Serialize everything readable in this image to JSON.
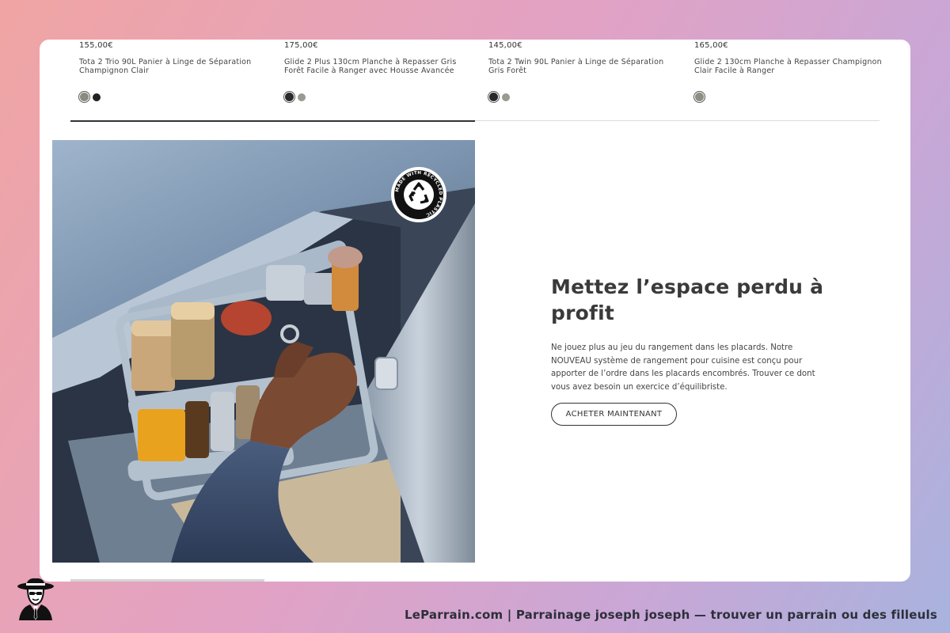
{
  "products": [
    {
      "price": "155,00€",
      "name": "Tota 2 Trio 90L Panier à Linge de Séparation Champignon Clair",
      "swatches": [
        "#8a8a80",
        "#222222"
      ],
      "selected": 0
    },
    {
      "price": "175,00€",
      "name": "Glide 2 Plus 130cm Planche à Repasser Gris Forêt Facile à Ranger avec Housse Avancée",
      "swatches": [
        "#2a2a2a",
        "#9a9a90"
      ],
      "selected": 0
    },
    {
      "price": "145,00€",
      "name": "Tota 2 Twin 90L Panier à Linge de Séparation Gris Forêt",
      "swatches": [
        "#2a2a2a",
        "#9a9a90"
      ],
      "selected": 0
    },
    {
      "price": "165,00€",
      "name": "Glide 2 130cm Planche à Repasser Champignon Clair Facile à Ranger",
      "swatches": [
        "#8e8e84"
      ],
      "selected": 0
    }
  ],
  "promo": {
    "badge_text": "MADE WITH RECYCLED PLASTIC",
    "title": "Mettez l’espace perdu à profit",
    "body": "Ne jouez plus au jeu du rangement dans les placards. Notre NOUVEAU système de rangement pour cuisine est conçu pour apporter de l’ordre dans les placards encombrés. Trouver ce dont vous avez besoin un exercice d’équilibriste.",
    "cta": "ACHETER MAINTENANT"
  },
  "footer": {
    "text": "LeParrain.com | Parrainage joseph joseph — trouver un parrain ou des filleuls"
  },
  "colors": {
    "accent_dark": "#333333",
    "title": "#3a3a3a"
  }
}
